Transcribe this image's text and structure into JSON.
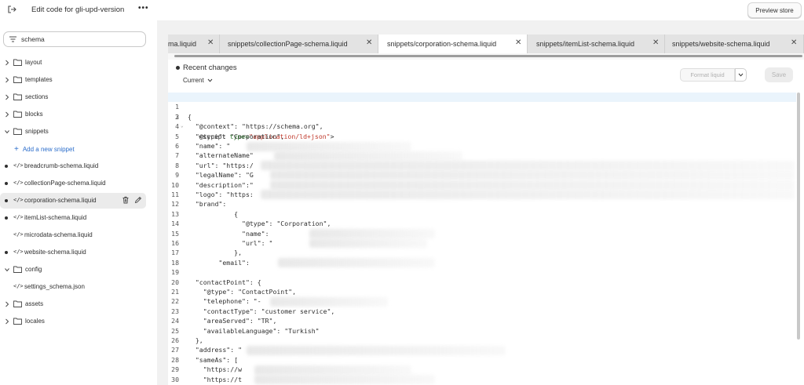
{
  "topbar": {
    "title": "Edit code for gli-upd-version",
    "more_label": "•••",
    "preview_label": "Preview store"
  },
  "sidebar": {
    "search_value": "schema",
    "folders": [
      {
        "label": "layout"
      },
      {
        "label": "templates"
      },
      {
        "label": "sections"
      },
      {
        "label": "blocks"
      },
      {
        "label": "snippets"
      },
      {
        "label": "config"
      },
      {
        "label": "assets"
      },
      {
        "label": "locales"
      }
    ],
    "add_snippet_label": "Add a new snippet",
    "snippet_files": [
      {
        "label": "breadcrumb-schema.liquid"
      },
      {
        "label": "collectionPage-schema.liquid"
      },
      {
        "label": "corporation-schema.liquid"
      },
      {
        "label": "itemList-schema.liquid"
      },
      {
        "label": "microdata-schema.liquid"
      },
      {
        "label": "website-schema.liquid"
      }
    ],
    "config_files": [
      {
        "label": "settings_schema.json"
      }
    ],
    "code_glyph": "</>"
  },
  "tabs": [
    {
      "label": "ma.liquid"
    },
    {
      "label": "snippets/collectionPage-schema.liquid"
    },
    {
      "prefix": "snippets/",
      "name": "corporation-schema.liquid"
    },
    {
      "label": "snippets/itemList-schema.liquid"
    },
    {
      "label": "snippets/website-schema.liquid"
    }
  ],
  "close_glyph": "✕",
  "editor": {
    "recent_changes_label": "Recent changes",
    "current_label": "Current",
    "format_label": "Format liquid",
    "save_label": "Save"
  },
  "code": {
    "line_numbers": [
      "1",
      "2",
      "3",
      "4",
      "5",
      "6",
      "7",
      "8",
      "9",
      "10",
      "11",
      "12",
      "13",
      "14",
      "15",
      "16",
      "17",
      "18",
      "19",
      "20",
      "21",
      "22",
      "23",
      "24",
      "25",
      "26",
      "27",
      "28",
      "29",
      "30"
    ],
    "l2_pre": "<script ",
    "l2_attr": "type=",
    "l2_str": "\"application/ld+json\"",
    "l2_post": ">",
    "lines": [
      "",
      "",
      "{",
      "  \"@context\": \"https://schema.org\",",
      "  \"@type\": \"Corporation\",",
      "  \"name\": \"",
      "  \"alternateName\"",
      "  \"url\": \"https:/",
      "  \"legalName\": \"G",
      "  \"description\":\"",
      "  \"logo\": \"https:",
      "  \"brand\":",
      "            {",
      "              \"@type\": \"Corporation\",",
      "              \"name\": ",
      "              \"url\": \"",
      "            },",
      "        \"email\": ",
      "",
      "  \"contactPoint\": {",
      "    \"@type\": \"ContactPoint\",",
      "    \"telephone\": \"-",
      "    \"contactType\": \"customer service\",",
      "    \"areaServed\": \"TR\",",
      "    \"availableLanguage\": \"Turkish\"",
      "  },",
      "  \"address\": \"",
      "  \"sameAs\": [",
      "    \"https://w",
      "    \"https://t"
    ]
  }
}
